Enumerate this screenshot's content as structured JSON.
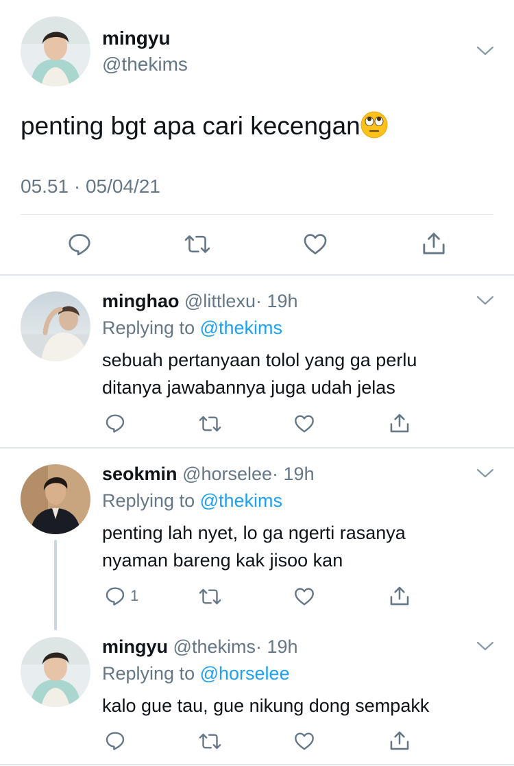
{
  "main_tweet": {
    "display_name": "mingyu",
    "handle": "@thekims",
    "text": "penting bgt apa cari kecengan",
    "emoji": "🙄",
    "timestamp": "05.51 · 05/04/21"
  },
  "replies": [
    {
      "display_name": "minghao",
      "handle": "@littlexu",
      "time": "· 19h",
      "replying_prefix": "Replying to",
      "replying_to": "@thekims",
      "text_line1": "sebuah pertanyaan tolol yang ga perlu",
      "text_line2": "ditanya jawabannya juga udah jelas",
      "reply_count": ""
    },
    {
      "display_name": "seokmin",
      "handle": "@horselee",
      "time": "· 19h",
      "replying_prefix": "Replying to",
      "replying_to": "@thekims",
      "text_line1": "penting lah nyet, lo ga ngerti rasanya",
      "text_line2": "nyaman bareng kak jisoo kan",
      "reply_count": "1"
    },
    {
      "display_name": "mingyu",
      "handle": "@thekims",
      "time": "· 19h",
      "replying_prefix": "Replying to",
      "replying_to": "@horselee",
      "text_line1": "kalo gue tau, gue nikung dong sempakk",
      "text_line2": "",
      "reply_count": ""
    }
  ],
  "icons": [
    "reply-icon",
    "retweet-icon",
    "like-icon",
    "share-icon",
    "chevron-down-icon"
  ],
  "colors": {
    "text": "#0f1419",
    "secondary": "#657786",
    "link": "#1da1f2",
    "divider": "#e1e8ed"
  }
}
